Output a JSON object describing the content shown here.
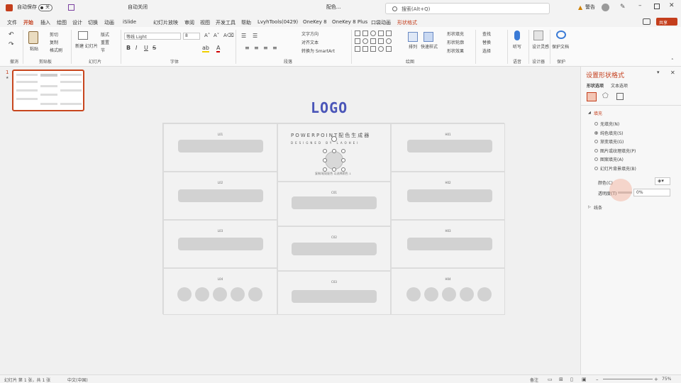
{
  "titlebar": {
    "autosave": "自动保存",
    "toggle": "关",
    "autoclose_label": "自动关闭",
    "filename": "配色...",
    "search_placeholder": "搜索(Alt+Q)",
    "warning": "警告",
    "share": "共享"
  },
  "menu": {
    "tabs": [
      "文件",
      "开始",
      "插入",
      "绘图",
      "设计",
      "切换",
      "动画",
      "幻灯片放映",
      "审阅",
      "视图",
      "开发工具",
      "帮助",
      "iSlide",
      "LvyhTools(0429)",
      "OneKey 8",
      "OneKey 8 Plus",
      "口袋动画",
      "形状格式"
    ],
    "active_tab": "开始"
  },
  "ribbon": {
    "groups": [
      "撤消",
      "剪贴板",
      "幻灯片",
      "字体",
      "段落",
      "绘图",
      "语音",
      "设计器",
      "保护"
    ],
    "paste": "粘贴",
    "cut": "剪切",
    "copy": "复制",
    "format_painter": "格式刷",
    "new_slide": "新建\n幻灯片",
    "layout": "版式",
    "reset": "重置",
    "section": "节",
    "font_name": "等线 Light",
    "font_size": "8",
    "text_direction": "文字方向",
    "align_text": "对齐文本",
    "convert_smartart": "转换为 SmartArt",
    "arrange": "排列",
    "quick_styles": "快速样式",
    "shape_fill": "形状填充",
    "shape_outline": "形状轮廓",
    "shape_effects": "形状效果",
    "find": "查找",
    "replace": "替换",
    "select": "选择",
    "dictate": "听写",
    "designer": "设计灵感",
    "protect": "保护文档"
  },
  "slide": {
    "number": "1",
    "logo": "LOGO",
    "title": "POWERPOINT配色生成器",
    "subtitle": "DESIGNED BY LAOHEI",
    "hint": "复制/粘贴配色 以选择颜色 ↓",
    "cells": {
      "left": [
        "L01",
        "L02",
        "L03",
        "L04"
      ],
      "center": [
        "C01",
        "C02",
        "C03"
      ],
      "right": [
        "H01",
        "H02",
        "H03",
        "H04"
      ]
    }
  },
  "format_panel": {
    "title": "设置形状格式",
    "tab_shape": "形状选项",
    "tab_text": "文本选项",
    "section_fill": "填充",
    "fill_options": [
      "无填充(N)",
      "纯色填充(S)",
      "渐变填充(G)",
      "图片或纹理填充(P)",
      "图案填充(A)",
      "幻灯片背景填充(B)"
    ],
    "selected_fill": "纯色填充(S)",
    "color_label": "颜色(C)",
    "transparency_label": "透明度(T)",
    "transparency_value": "0%",
    "section_line": "线条"
  },
  "status": {
    "slide_info": "幻灯片 第 1 张，共 1 张",
    "language": "中文(中国)",
    "notes": "备注",
    "zoom": "75%"
  },
  "colors": {
    "accent": "#c43e1c",
    "logo": "#4a55b8",
    "title_accent": "#3a8fd9"
  }
}
